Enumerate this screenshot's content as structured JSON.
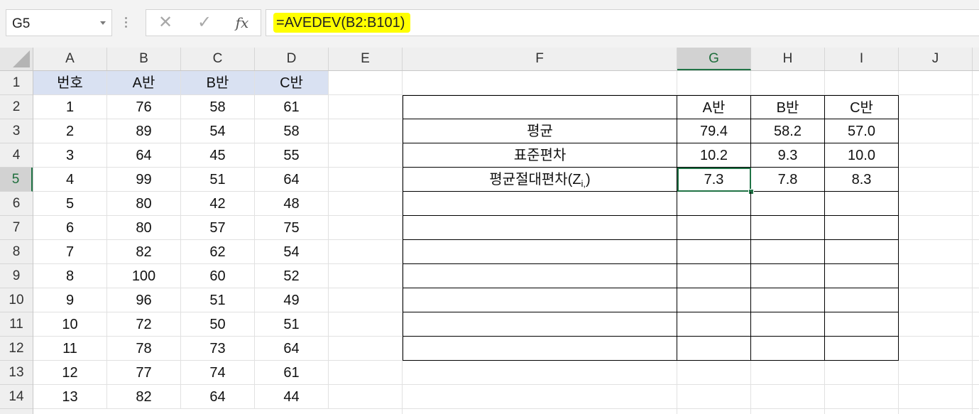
{
  "name_box": {
    "value": "G5"
  },
  "formula_bar": {
    "cancel_glyph": "✕",
    "enter_glyph": "✓",
    "fx_label": "fx",
    "formula": "=AVEDEV(B2:B101)"
  },
  "columns": [
    "A",
    "B",
    "C",
    "D",
    "E",
    "F",
    "G",
    "H",
    "I",
    "J"
  ],
  "rows": [
    "1",
    "2",
    "3",
    "4",
    "5",
    "6",
    "7",
    "8",
    "9",
    "10",
    "11",
    "12",
    "13",
    "14"
  ],
  "data_table": {
    "headers": [
      "번호",
      "A반",
      "B반",
      "C반"
    ],
    "rows": [
      [
        "1",
        "76",
        "58",
        "61"
      ],
      [
        "2",
        "89",
        "54",
        "58"
      ],
      [
        "3",
        "64",
        "45",
        "55"
      ],
      [
        "4",
        "99",
        "51",
        "64"
      ],
      [
        "5",
        "80",
        "42",
        "48"
      ],
      [
        "6",
        "80",
        "57",
        "75"
      ],
      [
        "7",
        "82",
        "62",
        "54"
      ],
      [
        "8",
        "100",
        "60",
        "52"
      ],
      [
        "9",
        "96",
        "51",
        "49"
      ],
      [
        "10",
        "72",
        "50",
        "51"
      ],
      [
        "11",
        "78",
        "73",
        "64"
      ],
      [
        "12",
        "77",
        "74",
        "61"
      ],
      [
        "13",
        "82",
        "64",
        "44"
      ]
    ]
  },
  "stats_table": {
    "headers": [
      "",
      "A반",
      "B반",
      "C반"
    ],
    "rows": [
      {
        "label": "평균",
        "values": [
          "79.4",
          "58.2",
          "57.0"
        ]
      },
      {
        "label": "표준편차",
        "values": [
          "10.2",
          "9.3",
          "10.0"
        ]
      },
      {
        "label_main": "평균절대편차(Z",
        "label_sub": "i,",
        "label_tail": ")",
        "values": [
          "7.3",
          "7.8",
          "8.3"
        ]
      }
    ]
  },
  "selection": {
    "cell": "G5",
    "color": "#217346"
  },
  "colors": {
    "header_fill": "#d9e1f2",
    "formula_highlight": "#ffff00"
  }
}
